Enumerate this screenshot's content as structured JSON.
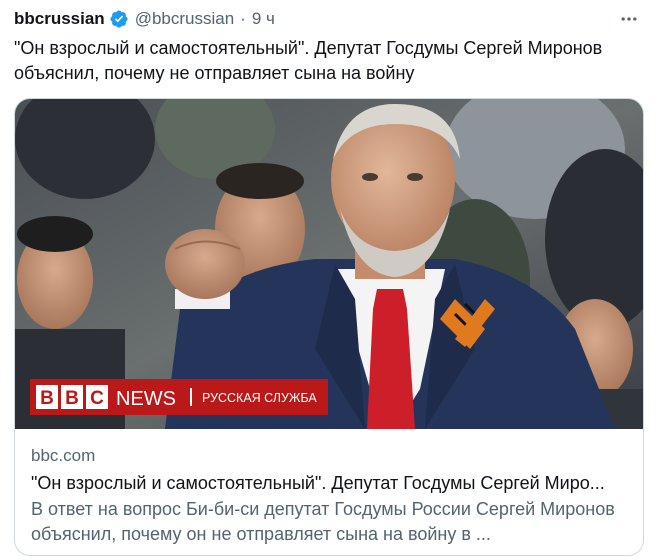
{
  "tweet": {
    "author_name": "bbcrussian",
    "handle": "@bbcrussian",
    "separator": "·",
    "time": "9 ч",
    "text": "\"Он взрослый и самостоятельный\". Депутат Госдумы Сергей Миронов объяснил, почему не отправляет сына на войну"
  },
  "card": {
    "domain": "bbc.com",
    "title": "\"Он взрослый и самостоятельный\". Депутат Госдумы Сергей Миро...",
    "description": "В ответ на вопрос Би-би-си депутат Госдумы России Сергей Миронов объяснил, почему он не отправляет сына на войну в ...",
    "image_logo": {
      "letters": [
        "B",
        "B",
        "C"
      ],
      "news": "NEWS",
      "service": "РУССКАЯ СЛУЖБА"
    }
  },
  "icons": {
    "verified": "verified-badge-icon",
    "more": "more-options-icon"
  },
  "colors": {
    "verified_blue": "#1d9bf0",
    "bbc_red": "#bb1919",
    "secondary_text": "#536471",
    "primary_text": "#0f1419",
    "card_border": "#cfd9de"
  }
}
